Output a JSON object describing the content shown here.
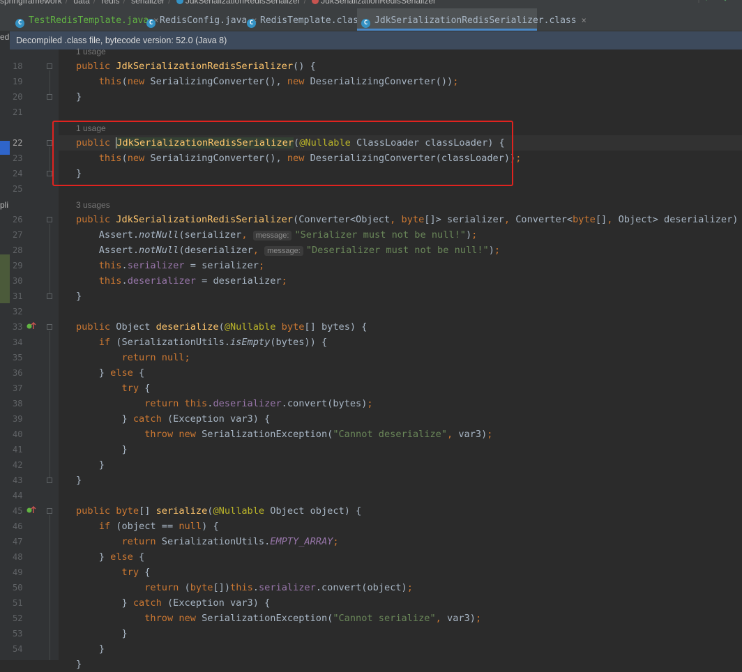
{
  "breadcrumb": {
    "items": [
      "springframework",
      "data",
      "redis",
      "serializer",
      "JdkSerializationRedisSerializer",
      "JdkSerializationRedisSerializer"
    ]
  },
  "tabs": [
    {
      "label": "TestRedisTemplate.java",
      "icon": "java-class-icon"
    },
    {
      "label": "RedisConfig.java",
      "icon": "class-icon"
    },
    {
      "label": "RedisTemplate.class",
      "icon": "class-icon"
    },
    {
      "label": "JdkSerializationRedisSerializer.class",
      "icon": "class-icon",
      "active": true
    }
  ],
  "close_glyph": "×",
  "infobar": {
    "text": "Decompiled .class file, bytecode version: 52.0 (Java 8)"
  },
  "left_strip": {
    "ed": "ed",
    "pli": "pli"
  },
  "usages": {
    "u18": "1 usage",
    "u22": "1 usage",
    "u26": "3 usages"
  },
  "hints": {
    "message": "message:"
  },
  "strings": {
    "s27": "\"Serializer must not be null!\"",
    "s28": "\"Deserializer must not be null!\"",
    "s40": "\"Cannot deserialize\"",
    "s52": "\"Cannot serialize\""
  },
  "line_numbers": [
    "18",
    "19",
    "20",
    "21",
    "22",
    "23",
    "24",
    "25",
    "26",
    "27",
    "28",
    "29",
    "30",
    "31",
    "32",
    "33",
    "34",
    "35",
    "36",
    "37",
    "38",
    "39",
    "40",
    "41",
    "42",
    "43",
    "44",
    "45",
    "46",
    "47",
    "48",
    "49",
    "50",
    "51",
    "52",
    "53",
    "54"
  ],
  "colors": {
    "keyword": "#cc7832",
    "method": "#ffc66d",
    "annotation": "#bbb529",
    "string": "#6a8759",
    "field": "#9876aa",
    "highlight_box": "#e0231f"
  }
}
